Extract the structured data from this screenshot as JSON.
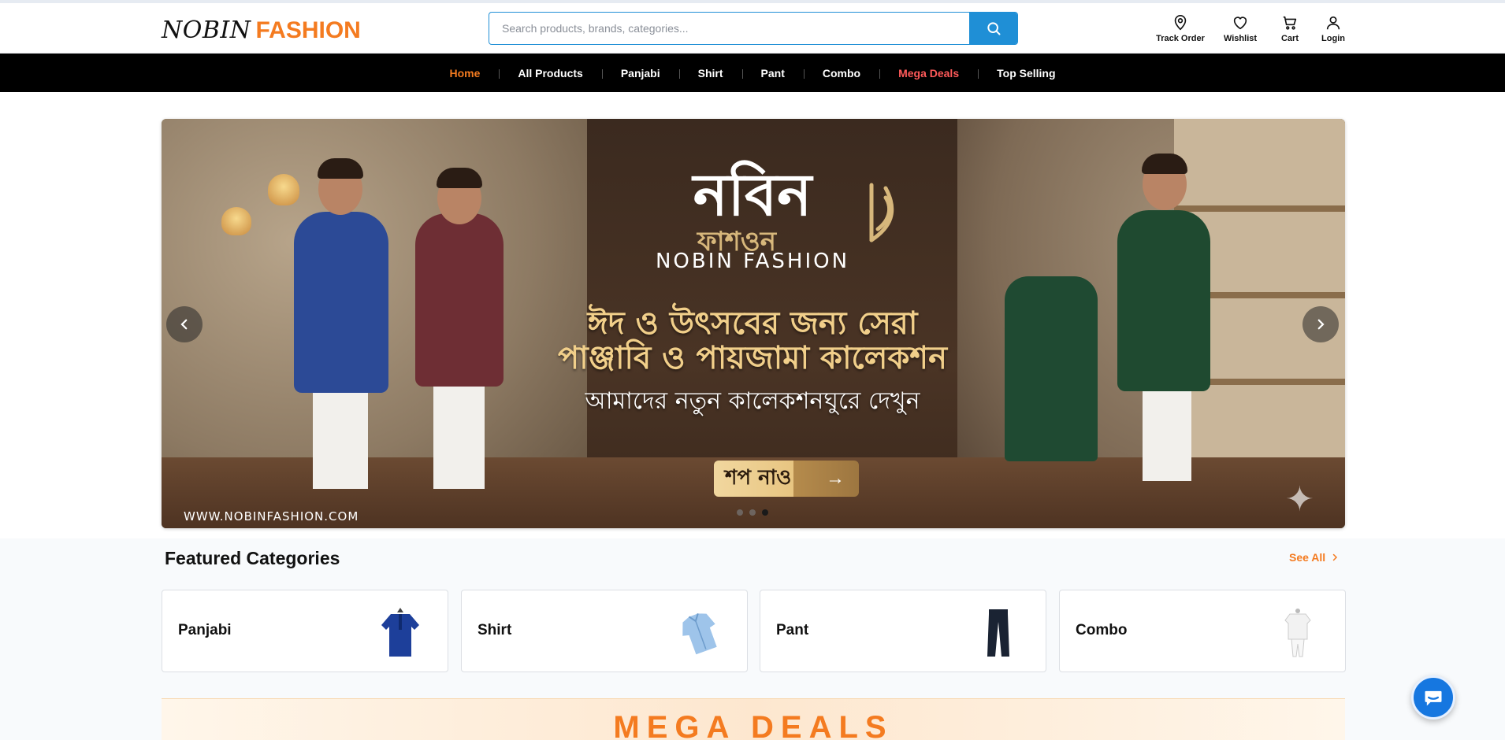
{
  "header": {
    "logo_part1": "NOBIN",
    "logo_part2": "FASHION",
    "search_placeholder": "Search products, brands, categories...",
    "icons": [
      {
        "label": "Track Order",
        "icon": "location-pin-icon"
      },
      {
        "label": "Wishlist",
        "icon": "heart-icon"
      },
      {
        "label": "Cart",
        "icon": "cart-icon"
      },
      {
        "label": "Login",
        "icon": "user-icon"
      }
    ]
  },
  "nav": {
    "items": [
      "Home",
      "All Products",
      "Panjabi",
      "Shirt",
      "Pant",
      "Combo",
      "Mega Deals",
      "Top Selling"
    ],
    "active": "Home"
  },
  "banner": {
    "brand_bn": "নবিন",
    "brand_bn2": "ফাশওন",
    "brand_en": "NOBIN FASHION",
    "headline_line1": "ঈদ ও উৎসবের জন্য সেরা",
    "headline_line2": "পাঞ্জাবি ও পায়জামা কালেকশন",
    "subheadline": "আমাদের নতুন কালেকশনঘুরে দেখুন",
    "cta": "শপ নাও",
    "url": "WWW.NOBINFASHION.COM",
    "slides": 3,
    "active_slide": 3
  },
  "featured": {
    "title": "Featured Categories",
    "see_all": "See All",
    "categories": [
      {
        "name": "Panjabi",
        "icon": "panjabi-image"
      },
      {
        "name": "Shirt",
        "icon": "shirt-image"
      },
      {
        "name": "Pant",
        "icon": "pant-image"
      },
      {
        "name": "Combo",
        "icon": "combo-image"
      }
    ]
  },
  "deals": {
    "title": "MEGA DEALS"
  },
  "colors": {
    "accent": "#f47b20",
    "primary": "#1f8fd6",
    "nav_bg": "#000000",
    "deal_red": "#ff5a5a",
    "chat": "#1677e0"
  }
}
